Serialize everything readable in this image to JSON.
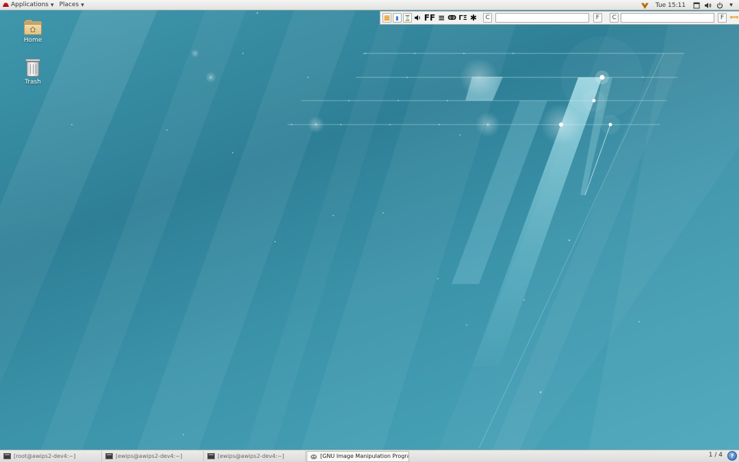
{
  "top_panel": {
    "applications_label": "Applications",
    "places_label": "Places",
    "clock": "Tue 15:11"
  },
  "floating_toolbar": {
    "buttons": [
      {
        "icon": "grid-icon",
        "glyph": "▦"
      },
      {
        "icon": "battery-icon",
        "glyph": "▮"
      },
      {
        "icon": "hourglass-icon",
        "glyph": "⌛"
      },
      {
        "icon": "speaker-icon",
        "glyph": "🔊"
      },
      {
        "icon": "ff-icon",
        "glyph": "FF"
      },
      {
        "icon": "menu-lines-icon",
        "glyph": "≡"
      },
      {
        "icon": "network-icon",
        "glyph": "ↂ"
      },
      {
        "icon": "tag-icon",
        "glyph": "ΓΞ"
      },
      {
        "icon": "asterisk-icon",
        "glyph": "✱"
      }
    ],
    "field1_prefix": "C",
    "field1_value": "",
    "field1_suffix": "F",
    "field2_prefix": "C",
    "field2_value": "",
    "field2_suffix": "F"
  },
  "desktop_icons": [
    {
      "label": "Home"
    },
    {
      "label": "Trash"
    }
  ],
  "taskbar": {
    "tasks": [
      {
        "label": "[root@awips2-dev4:~]"
      },
      {
        "label": "[ewips@awips2-dev4:~]"
      },
      {
        "label": "[ewips@awips2-dev4:~]"
      },
      {
        "label": "[GNU Image Manipulation Program]"
      }
    ],
    "workspace": "1 / 4",
    "help_glyph": "?"
  },
  "colors": {
    "desktop_base": "#3f97ac",
    "desktop_dark": "#2e7f96",
    "panel_bg": "#e8e8e6",
    "accent_orange": "#e08a00"
  }
}
